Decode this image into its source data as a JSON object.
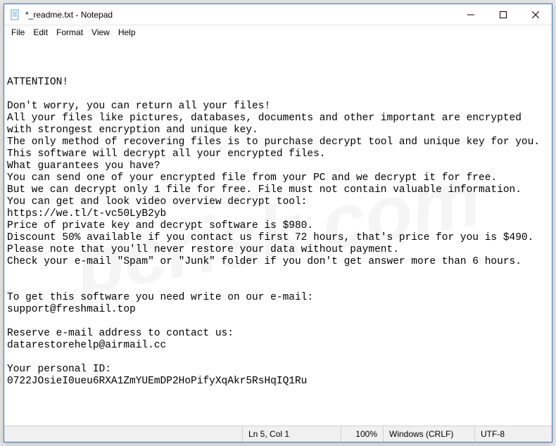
{
  "window": {
    "title": "*_readme.txt - Notepad"
  },
  "menubar": {
    "items": [
      "File",
      "Edit",
      "Format",
      "View",
      "Help"
    ]
  },
  "content": {
    "text": "ATTENTION!\n\nDon't worry, you can return all your files!\nAll your files like pictures, databases, documents and other important are encrypted with strongest encryption and unique key.\nThe only method of recovering files is to purchase decrypt tool and unique key for you.\nThis software will decrypt all your encrypted files.\nWhat guarantees you have?\nYou can send one of your encrypted file from your PC and we decrypt it for free.\nBut we can decrypt only 1 file for free. File must not contain valuable information.\nYou can get and look video overview decrypt tool:\nhttps://we.tl/t-vc50LyB2yb\nPrice of private key and decrypt software is $980.\nDiscount 50% available if you contact us first 72 hours, that's price for you is $490.\nPlease note that you'll never restore your data without payment.\nCheck your e-mail \"Spam\" or \"Junk\" folder if you don't get answer more than 6 hours.\n\n\nTo get this software you need write on our e-mail:\nsupport@freshmail.top\n\nReserve e-mail address to contact us:\ndatarestorehelp@airmail.cc\n\nYour personal ID:\n0722JOsieI0ueu6RXA1ZmYUEmDP2HoPifyXqAkr5RsHqIQ1Ru"
  },
  "statusbar": {
    "lncol": "Ln 5, Col 1",
    "zoom": "100%",
    "lineend": "Windows (CRLF)",
    "encoding": "UTF-8"
  },
  "watermark": "pcrisk.com"
}
